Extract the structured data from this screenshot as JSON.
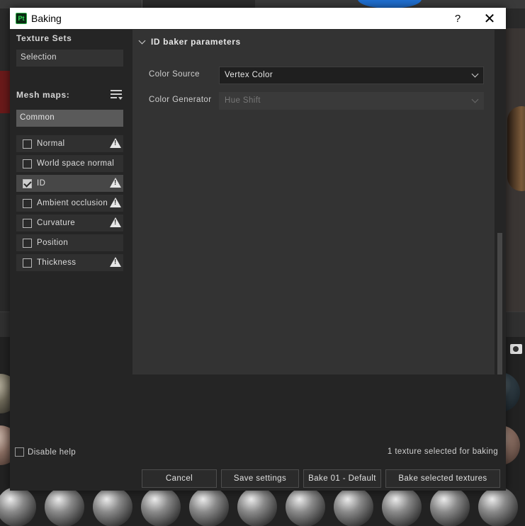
{
  "window": {
    "title": "Baking",
    "app_icon": "Pt",
    "help": "?",
    "close": "✕"
  },
  "left": {
    "texture_sets_title": "Texture Sets",
    "selection": "Selection",
    "mesh_maps_title": "Mesh maps:",
    "group": "Common",
    "maps": [
      {
        "label": "Normal",
        "checked": false,
        "warning": true
      },
      {
        "label": "World space normal",
        "checked": false,
        "warning": false
      },
      {
        "label": "ID",
        "checked": true,
        "warning": true
      },
      {
        "label": "Ambient occlusion",
        "checked": false,
        "warning": true
      },
      {
        "label": "Curvature",
        "checked": false,
        "warning": true
      },
      {
        "label": "Position",
        "checked": false,
        "warning": false
      },
      {
        "label": "Thickness",
        "checked": false,
        "warning": true
      }
    ]
  },
  "params": {
    "title": "ID baker parameters",
    "color_source_label": "Color Source",
    "color_source_value": "Vertex Color",
    "color_generator_label": "Color Generator",
    "color_generator_value": "Hue Shift"
  },
  "footer": {
    "disable_help": "Disable help",
    "status": "1 texture selected for baking",
    "cancel": "Cancel",
    "save_settings": "Save settings",
    "bake_default": "Bake 01 - Default",
    "bake_selected": "Bake selected textures"
  },
  "colors": {
    "accent": "#2fdc58",
    "dialog_bg": "#252525",
    "panel_bg": "#333333"
  }
}
